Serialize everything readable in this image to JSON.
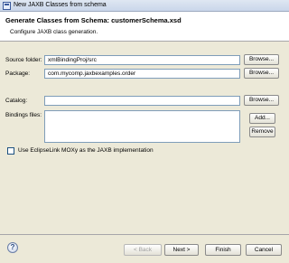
{
  "window": {
    "title": "New JAXB Classes from schema"
  },
  "header": {
    "title": "Generate Classes from Schema: customerSchema.xsd",
    "description": "Configure JAXB class generation."
  },
  "form": {
    "source_folder": {
      "label": "Source folder:",
      "value": "xmlBindingProj/src",
      "browse": "Browse..."
    },
    "package": {
      "label": "Package:",
      "value": "com.mycomp.jaxbexamples.order",
      "browse": "Browse..."
    },
    "catalog": {
      "label": "Catalog:",
      "value": "",
      "browse": "Browse..."
    },
    "bindings_files": {
      "label": "Bindings files:",
      "add": "Add...",
      "remove": "Remove"
    },
    "moxy_checkbox": {
      "label": "Use EclipseLink MOXy as the JAXB implementation",
      "checked": false
    }
  },
  "footer": {
    "back": "< Back",
    "next": "Next >",
    "finish": "Finish",
    "cancel": "Cancel",
    "help_icon": "?"
  }
}
